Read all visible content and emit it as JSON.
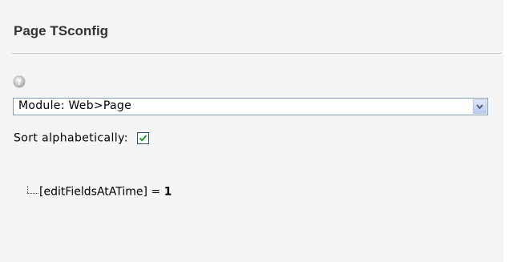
{
  "header": {
    "title": "Page TSconfig"
  },
  "help": {
    "icon": "help-icon"
  },
  "module_select": {
    "selected": "Module: Web>Page",
    "icon": "chevron-down-icon"
  },
  "sort": {
    "label": "Sort alphabetically:",
    "checked": true
  },
  "tree": {
    "items": [
      {
        "key": "[editFieldsAtATime]",
        "operator": " = ",
        "value": "1"
      }
    ]
  },
  "colors": {
    "panel_background": "#f5f5f5",
    "select_border": "#7f9db9",
    "checkmark": "#21a121"
  }
}
